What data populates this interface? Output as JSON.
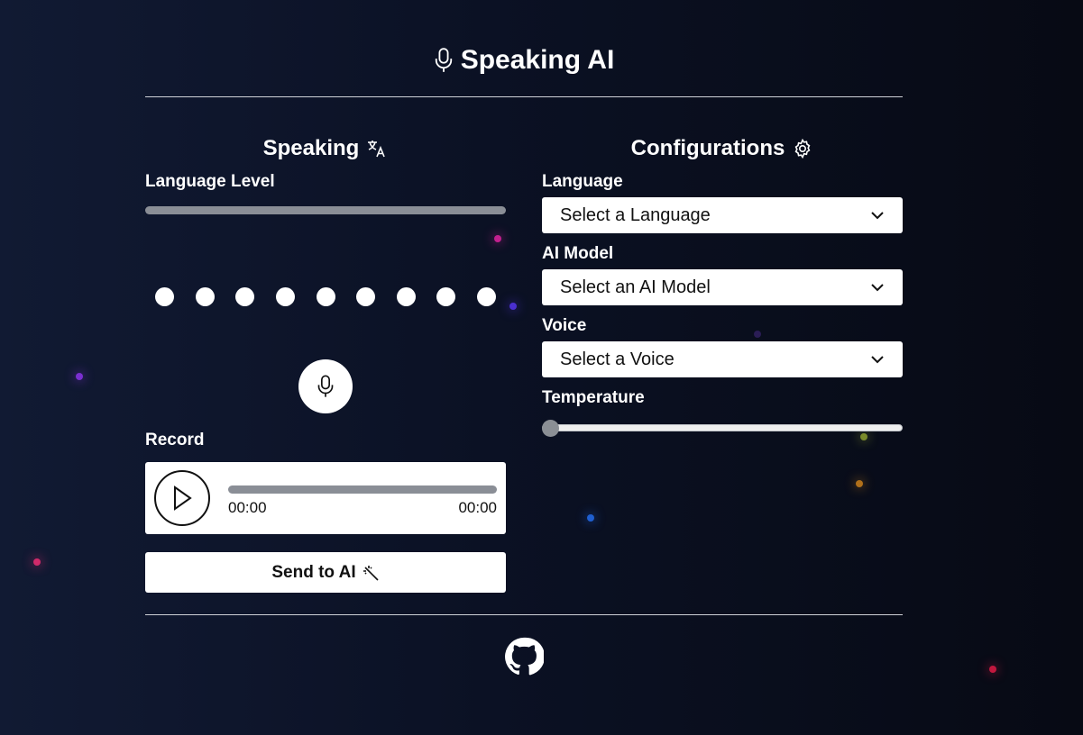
{
  "header": {
    "title": "Speaking AI",
    "icon": "microphone-icon"
  },
  "speaking": {
    "title": "Speaking",
    "title_icon": "translate-icon",
    "language_level_label": "Language Level",
    "language_level_fill": 0,
    "dots_count": 9,
    "mic_icon": "microphone-icon",
    "record_label": "Record",
    "player": {
      "current_time": "00:00",
      "duration": "00:00",
      "progress": 0
    },
    "send_label": "Send to AI",
    "send_icon": "magic-wand-icon"
  },
  "config": {
    "title": "Configurations",
    "title_icon": "gear-icon",
    "language": {
      "label": "Language",
      "value": "Select a Language"
    },
    "model": {
      "label": "AI Model",
      "value": "Select an AI Model"
    },
    "voice": {
      "label": "Voice",
      "value": "Select a Voice"
    },
    "temperature": {
      "label": "Temperature",
      "value": 0
    }
  },
  "footer": {
    "icon": "github-icon"
  },
  "colors": {
    "background": "#0b1124",
    "accent": "#ffffff",
    "track": "#8a8e96"
  }
}
